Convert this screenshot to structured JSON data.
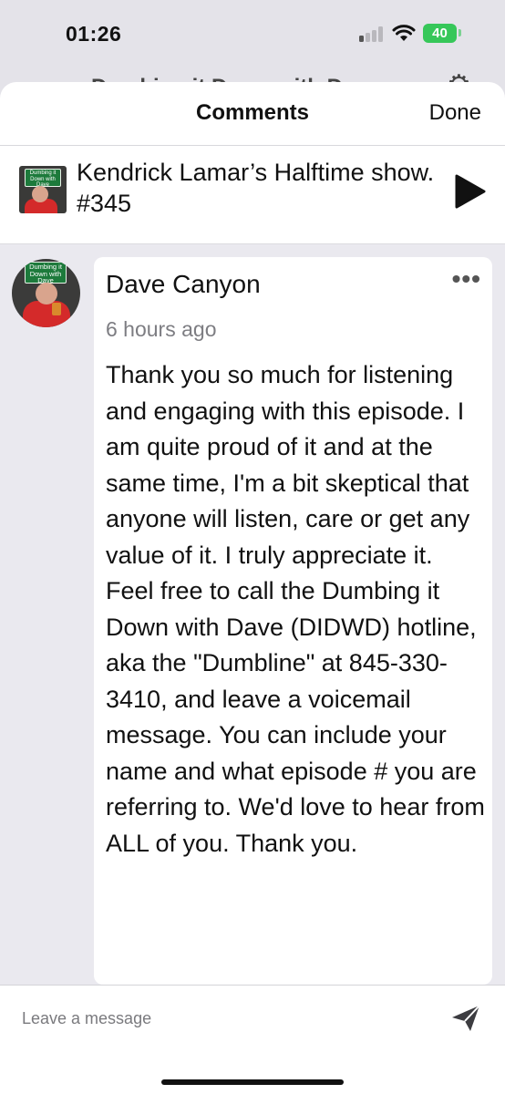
{
  "status_bar": {
    "time": "01:26",
    "battery": "40"
  },
  "background_nav": {
    "title": "Dumbing it Down with Dave"
  },
  "sheet": {
    "title": "Comments",
    "done_label": "Done"
  },
  "episode": {
    "title": "Kendrick Lamar’s Halftime show. #345",
    "art_text": "Dumbing it Down with Dave"
  },
  "comment": {
    "author": "Dave Canyon",
    "time": "6 hours ago",
    "body": "Thank you so much for listening and engaging with this episode. I am quite proud of it and at the same time, I'm a bit skeptical that anyone will listen, care or get any value of it.  I truly appreciate it. Feel free to call the Dumbing it Down with Dave (DIDWD) hotline, aka the \"Dumbline\" at 845-330-3410, and leave a voicemail message. You can include your name and what episode # you are referring to. We'd love to hear from ALL of you. Thank you.",
    "avatar_text": "Dumbing it Down with Dave",
    "more_label": "•••"
  },
  "composer": {
    "placeholder": "Leave a message"
  }
}
